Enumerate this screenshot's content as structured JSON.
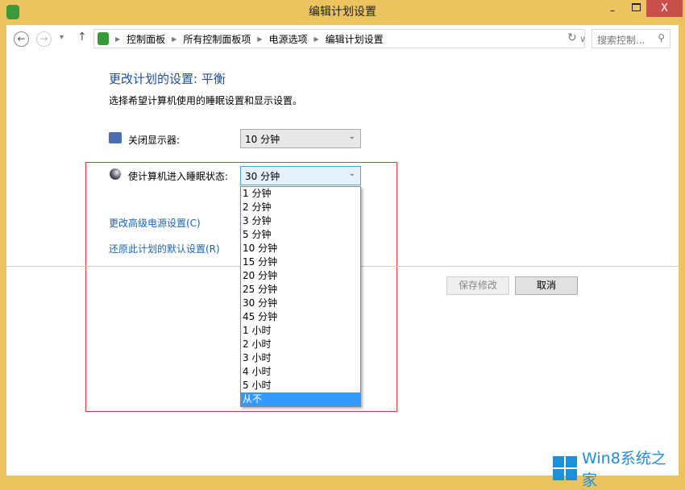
{
  "window": {
    "title": "编辑计划设置",
    "minimize": "–",
    "close": "X"
  },
  "nav": {
    "back": "←",
    "forward": "→",
    "recent": "▾",
    "up": "↑",
    "refresh": "↻",
    "dropdown": "∨",
    "breadcrumb": [
      "控制面板",
      "所有控制面板项",
      "电源选项",
      "编辑计划设置"
    ],
    "search_placeholder": "搜索控制...",
    "search_icon": "⚲"
  },
  "main": {
    "title": "更改计划的设置: 平衡",
    "subtitle": "选择希望计算机使用的睡眠设置和显示设置。",
    "display_label": "关闭显示器:",
    "display_value": "10 分钟",
    "sleep_label": "使计算机进入睡眠状态:",
    "sleep_value": "30 分钟",
    "advanced_link": "更改高级电源设置(C)",
    "restore_link": "还原此计划的默认设置(R)",
    "save": "保存修改",
    "cancel": "取消"
  },
  "dropdown": {
    "options": [
      "1 分钟",
      "2 分钟",
      "3 分钟",
      "5 分钟",
      "10 分钟",
      "15 分钟",
      "20 分钟",
      "25 分钟",
      "30 分钟",
      "45 分钟",
      "1 小时",
      "2 小时",
      "3 小时",
      "4 小时",
      "5 小时",
      "从不"
    ],
    "highlighted": "从不"
  },
  "watermark": "Win8系统之家"
}
